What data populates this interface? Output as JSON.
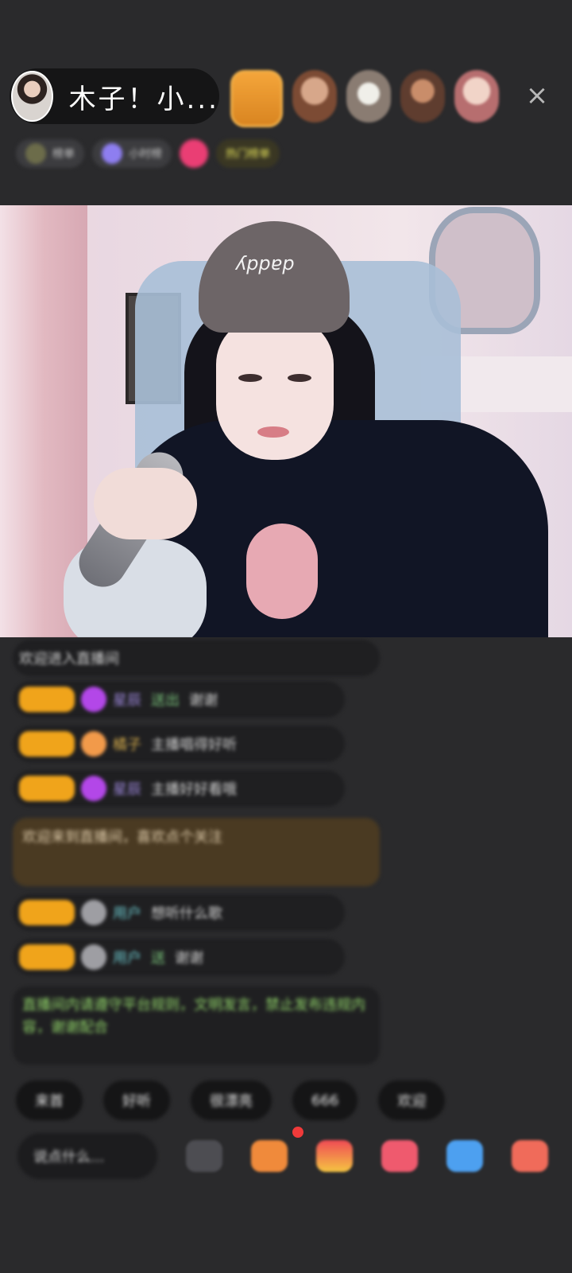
{
  "header": {
    "host_name": "木子！小...",
    "close_label": "×"
  },
  "info_strip": {
    "chips": [
      "榜单",
      "小时榜",
      "热门榜单"
    ]
  },
  "video": {
    "cap_text": "daddy"
  },
  "chat": {
    "line0": "欢迎进入直播间",
    "messages": [
      {
        "name": "星辰",
        "extra": "送出",
        "text": "谢谢"
      },
      {
        "name": "橘子",
        "extra": "",
        "text": "主播唱得好听"
      },
      {
        "name": "星辰",
        "extra": "",
        "text": "主播好好看哦"
      },
      {
        "name": "用户",
        "extra": "",
        "text": "想听什么歌"
      },
      {
        "name": "用户",
        "extra": "送",
        "text": "谢谢"
      }
    ],
    "brown_text": "欢迎来到直播间，喜欢点个关注",
    "green_text": "直播间内请遵守平台规则，文明发言，禁止发布违规内容，谢谢配合"
  },
  "quick_replies": [
    "来首",
    "好听",
    "很漂亮",
    "666",
    "欢迎"
  ],
  "bottom": {
    "say_placeholder": "说点什么..."
  },
  "colors": {
    "background": "#2a2a2c",
    "badge": "#f0a41b",
    "green_text": "#93d86b"
  }
}
